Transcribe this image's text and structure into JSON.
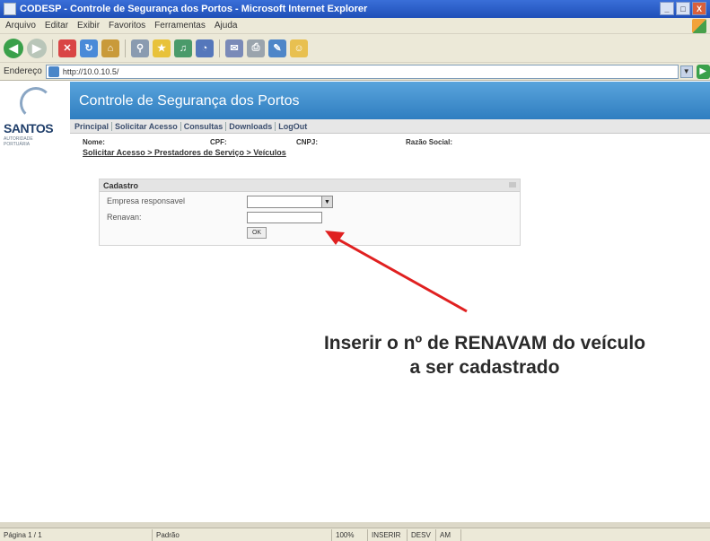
{
  "window": {
    "title": "CODESP - Controle de Segurança dos Portos - Microsoft Internet Explorer",
    "controls": [
      "_",
      "□",
      "X"
    ]
  },
  "menu": [
    "Arquivo",
    "Editar",
    "Exibir",
    "Favoritos",
    "Ferramentas",
    "Ajuda"
  ],
  "address": {
    "label": "Endereço",
    "url": "http://10.0.10.5/",
    "go_label": "▶"
  },
  "site": {
    "logo_name": "SANTOS",
    "logo_sub": "AUTORIDADE PORTUÁRIA",
    "title": "Controle de Segurança dos Portos"
  },
  "nav": [
    "Principal",
    "Solicitar Acesso",
    "Consultas",
    "Downloads",
    "LogOut"
  ],
  "info": {
    "nome": "Nome:",
    "cpf": "CPF:",
    "cnpj": "CNPJ:",
    "razao": "Razão Social:"
  },
  "breadcrumb": "Solicitar Acesso > Prestadores de Serviço > Veículos",
  "form": {
    "panel_title": "Cadastro",
    "empresa_label": "Empresa responsavel",
    "renavam_label": "Renavan:",
    "renavam_value": "",
    "ok_label": "OK"
  },
  "annotation": {
    "line1": "Inserir o nº de RENAVAM do veículo",
    "line2": "a ser cadastrado",
    "arrow_color": "#e02020"
  },
  "status": {
    "left": "Página 1 / 1",
    "mode": "Padrão",
    "zoom": "100%",
    "cells": [
      "INSERIR",
      "DESV",
      "AM"
    ]
  }
}
